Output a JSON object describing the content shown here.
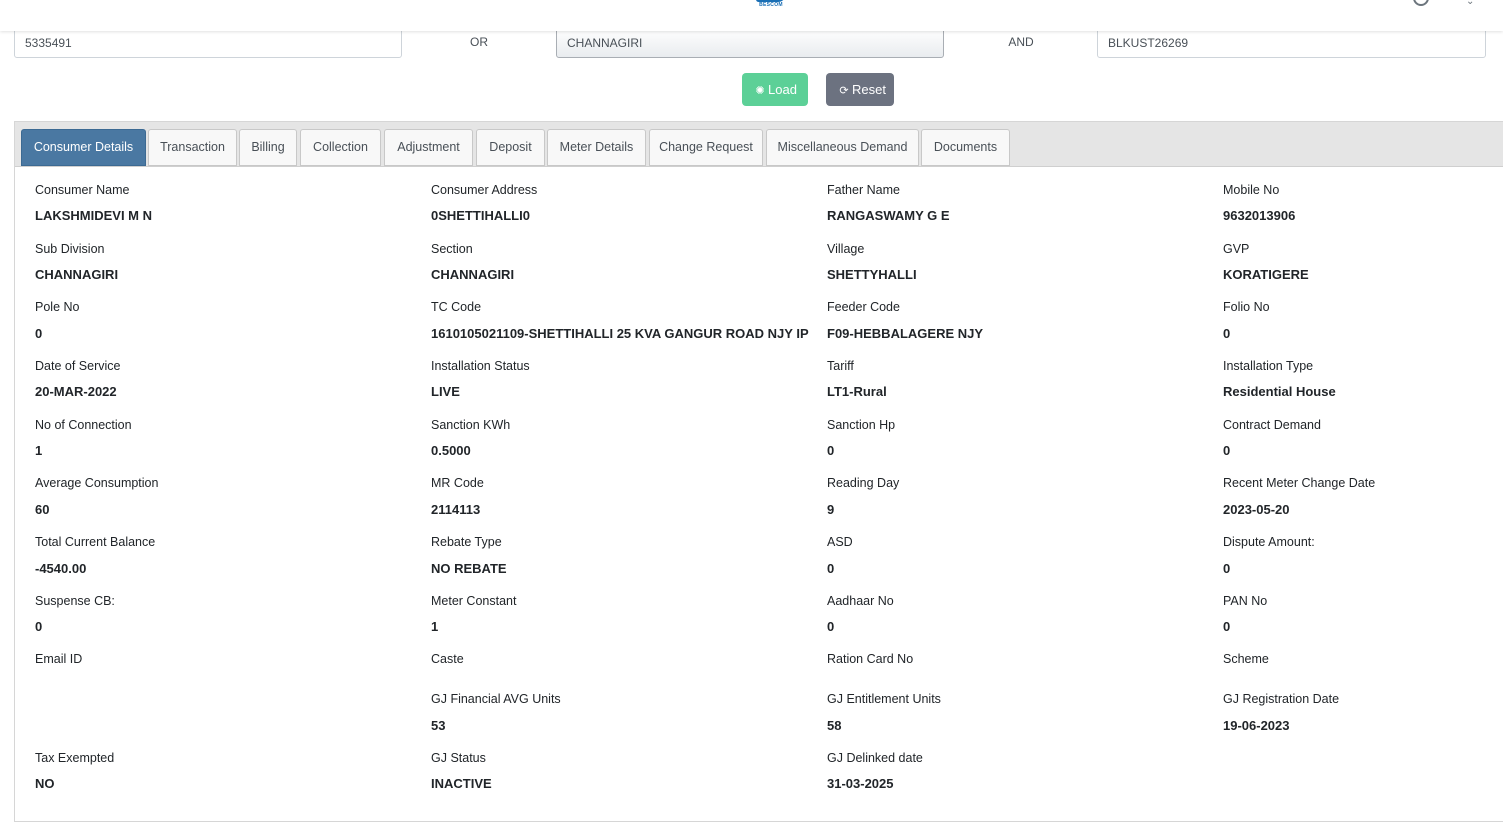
{
  "header": {
    "logo_text": "BESCOM",
    "user_icon": "user-circle-icon",
    "menu_icon": "caret-down-icon"
  },
  "search": {
    "account_id": "5335491",
    "or_label": "OR",
    "sub_division": "CHANNAGIRI",
    "and_label": "AND",
    "rr_number": "BLKUST26269"
  },
  "buttons": {
    "load": "Load",
    "reset": "Reset",
    "load_icon": "spinner-icon",
    "reset_icon": "refresh-icon"
  },
  "colors": {
    "load": "#5cd097",
    "reset": "#6c7280",
    "active_tab": "#4a78a2"
  },
  "tabs": [
    {
      "label": "Consumer Details",
      "active": true
    },
    {
      "label": "Transaction"
    },
    {
      "label": "Billing"
    },
    {
      "label": "Collection"
    },
    {
      "label": "Adjustment"
    },
    {
      "label": "Deposit"
    },
    {
      "label": "Meter Details"
    },
    {
      "label": "Change Request"
    },
    {
      "label": "Miscellaneous Demand"
    },
    {
      "label": "Documents"
    }
  ],
  "details": {
    "consumer_name": {
      "label": "Consumer Name",
      "value": "LAKSHMIDEVI M N"
    },
    "consumer_address": {
      "label": "Consumer Address",
      "value": "0SHETTIHALLI0"
    },
    "father_name": {
      "label": "Father Name",
      "value": "RANGASWAMY G E"
    },
    "mobile_no": {
      "label": "Mobile No",
      "value": "9632013906"
    },
    "sub_division": {
      "label": "Sub Division",
      "value": "CHANNAGIRI"
    },
    "section": {
      "label": "Section",
      "value": "CHANNAGIRI"
    },
    "village": {
      "label": "Village",
      "value": "SHETTYHALLI"
    },
    "gvp": {
      "label": "GVP",
      "value": "KORATIGERE"
    },
    "pole_no": {
      "label": "Pole No",
      "value": "0"
    },
    "tc_code": {
      "label": "TC Code",
      "value": "1610105021109-SHETTIHALLI 25 KVA GANGUR ROAD NJY IP"
    },
    "feeder_code": {
      "label": "Feeder Code",
      "value": "F09-HEBBALAGERE NJY"
    },
    "folio_no": {
      "label": "Folio No",
      "value": "0"
    },
    "date_of_service": {
      "label": "Date of Service",
      "value": "20-MAR-2022"
    },
    "installation_status": {
      "label": "Installation Status",
      "value": "LIVE"
    },
    "tariff": {
      "label": "Tariff",
      "value": "LT1-Rural"
    },
    "installation_type": {
      "label": "Installation Type",
      "value": "Residential House"
    },
    "no_of_connection": {
      "label": "No of Connection",
      "value": "1"
    },
    "sanction_kwh": {
      "label": "Sanction KWh",
      "value": "0.5000"
    },
    "sanction_hp": {
      "label": "Sanction Hp",
      "value": "0"
    },
    "contract_demand": {
      "label": "Contract Demand",
      "value": "0"
    },
    "average_consumption": {
      "label": "Average Consumption",
      "value": "60"
    },
    "mr_code": {
      "label": "MR Code",
      "value": "2114113"
    },
    "reading_day": {
      "label": "Reading Day",
      "value": "9"
    },
    "recent_meter_change_date": {
      "label": "Recent Meter Change Date",
      "value": "2023-05-20"
    },
    "total_current_balance": {
      "label": "Total Current Balance",
      "value": "-4540.00"
    },
    "rebate_type": {
      "label": "Rebate Type",
      "value": "NO REBATE"
    },
    "asd": {
      "label": "ASD",
      "value": "0"
    },
    "dispute_amount": {
      "label": "Dispute Amount:",
      "value": "0"
    },
    "suspense_cb": {
      "label": "Suspense CB:",
      "value": "0"
    },
    "meter_constant": {
      "label": "Meter Constant",
      "value": "1"
    },
    "aadhaar_no": {
      "label": "Aadhaar No",
      "value": "0"
    },
    "pan_no": {
      "label": "PAN No",
      "value": "0"
    },
    "email_id": {
      "label": "Email ID",
      "value": ""
    },
    "caste": {
      "label": "Caste",
      "value": ""
    },
    "ration_card_no": {
      "label": "Ration Card No",
      "value": ""
    },
    "scheme": {
      "label": "Scheme",
      "value": ""
    },
    "gj_financial_avg_units": {
      "label": "GJ Financial AVG Units",
      "value": "53"
    },
    "gj_entitlement_units": {
      "label": "GJ Entitlement Units",
      "value": "58"
    },
    "gj_registration_date": {
      "label": "GJ Registration Date",
      "value": "19-06-2023"
    },
    "tax_exempted": {
      "label": "Tax Exempted",
      "value": "NO"
    },
    "gj_status": {
      "label": "GJ Status",
      "value": "INACTIVE"
    },
    "gj_delinked_date": {
      "label": "GJ Delinked date",
      "value": "31-03-2025"
    }
  }
}
